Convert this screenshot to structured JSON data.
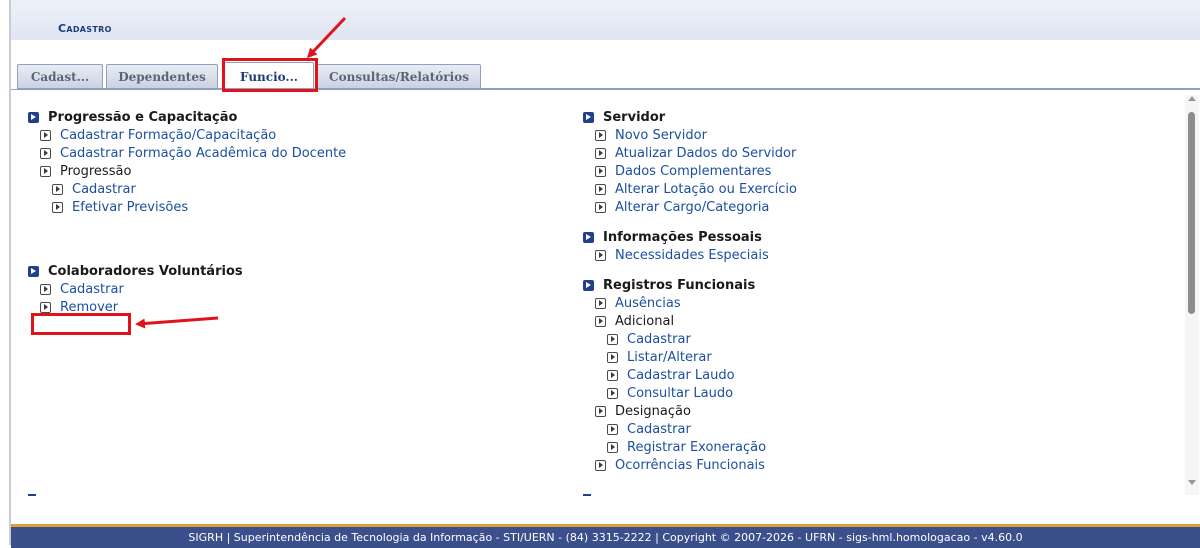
{
  "header": {
    "title": "Cadastro"
  },
  "tabs": [
    {
      "label": "Cadast...",
      "active": false
    },
    {
      "label": "Dependentes",
      "active": false
    },
    {
      "label": "Funcio...",
      "active": true
    },
    {
      "label": "Consultas/Relatórios",
      "active": false
    }
  ],
  "left_column": {
    "progressao": {
      "title": "Progressão e Capacitação",
      "items": [
        "Cadastrar Formação/Capacitação",
        "Cadastrar Formação Acadêmica do Docente"
      ],
      "sub_label": "Progressão",
      "sub_items": [
        "Cadastrar",
        "Efetivar Previsões"
      ]
    },
    "colaboradores": {
      "title": "Colaboradores Voluntários",
      "items": [
        "Cadastrar",
        "Remover"
      ]
    }
  },
  "right_column": {
    "servidor": {
      "title": "Servidor",
      "items": [
        "Novo Servidor",
        "Atualizar Dados do Servidor",
        "Dados Complementares",
        "Alterar Lotação ou Exercício",
        "Alterar Cargo/Categoria"
      ]
    },
    "informacoes": {
      "title": "Informações Pessoais",
      "items": [
        "Necessidades Especiais"
      ]
    },
    "registros": {
      "title": "Registros Funcionais",
      "ausencias": "Ausências",
      "adicional_label": "Adicional",
      "adicional_items": [
        "Cadastrar",
        "Listar/Alterar",
        "Cadastrar Laudo",
        "Consultar Laudo"
      ],
      "designacao_label": "Designação",
      "designacao_items": [
        "Cadastrar",
        "Registrar Exoneração"
      ],
      "ocorrencias": "Ocorrências Funcionais"
    }
  },
  "footer": {
    "text": "SIGRH | Superintendência de Tecnologia da Informação - STI/UERN - (84) 3315-2222 | Copyright © 2007-2026 - UFRN - sigs-hml.homologacao - v4.60.0"
  },
  "colors": {
    "accent": "#1c3c7a",
    "link": "#1c4fa0",
    "annotation": "#e0131a",
    "footer_bg": "#3a4f8b"
  }
}
